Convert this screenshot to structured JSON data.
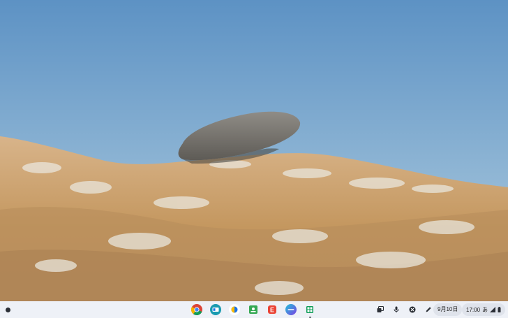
{
  "wallpaper": {
    "sky_top": "#5f93c3",
    "sky_bottom": "#b6d1e2",
    "grass_color": "#c29766"
  },
  "shelf": {
    "launcher_icon": "launcher-icon",
    "apps": [
      {
        "name": "chrome-icon"
      },
      {
        "name": "app-blue-icon"
      },
      {
        "name": "app-yellow-half-icon"
      },
      {
        "name": "app-green-icon"
      },
      {
        "name": "app-red-e-icon"
      },
      {
        "name": "app-purple-icon"
      },
      {
        "name": "app-teal-grid-icon"
      }
    ],
    "apps_running_index": 6,
    "tray": {
      "date": "9月10日",
      "time": "17:00",
      "ime": "あ"
    }
  }
}
